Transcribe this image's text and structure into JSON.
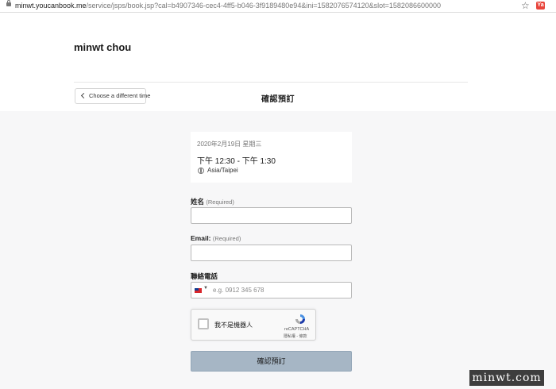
{
  "browser": {
    "url_host": "minwt.youcanbook.me",
    "url_path": "/service/jsps/book.jsp?cal=b4907346-cec4-4ff5-b046-3f9189480e94&ini=1582076574120&slot=1582086600000",
    "extension_label": "Ya"
  },
  "header": {
    "business_name": "minwt chou",
    "back_button_label": "Choose a different time",
    "page_title": "確認預訂"
  },
  "booking": {
    "date": "2020年2月19日 星期三",
    "time": "下午 12:30 - 下午 1:30",
    "timezone": "Asia/Taipei"
  },
  "form": {
    "name_label": "姓名",
    "name_required": "(Required)",
    "email_label": "Email:",
    "email_required": "(Required)",
    "phone_label": "聯絡電話",
    "phone_placeholder": "e.g. 0912 345 678"
  },
  "captcha": {
    "label": "我不是機器人",
    "brand": "reCAPTCHA",
    "terms": "隱私權 - 條款"
  },
  "submit_label": "確認預訂",
  "watermark": "minwt.com",
  "colors": {
    "submit_bg": "#a6b6c5",
    "page_bg": "#f7f7f8"
  },
  "icons": [
    "lock-icon",
    "star-icon",
    "chevron-left-icon",
    "globe-icon",
    "taiwan-flag-icon",
    "recaptcha-logo-icon"
  ]
}
